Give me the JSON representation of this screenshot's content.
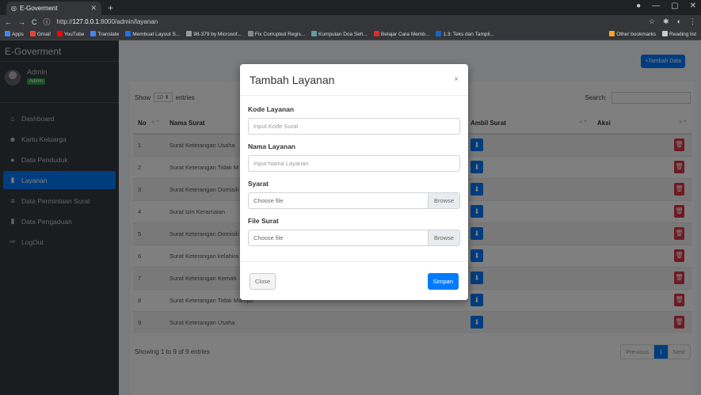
{
  "browser": {
    "tab_title": "E-Goverment",
    "url_prefix": "http://",
    "url_host": "127.0.0.1",
    "url_rest": ":8000/admin/layanan",
    "bookmarks": [
      "Apps",
      "Gmail",
      "YouTube",
      "Translate",
      "Membuat Layout S...",
      "98-379 by Microsof...",
      "Fix Corrupted Regis...",
      "Kumpulan Doa Seh...",
      "Belajar Cara Memb...",
      "1.3: Teks dan Tampil..."
    ],
    "bookmarks_right": [
      "Other bookmarks",
      "Reading list"
    ]
  },
  "sidebar": {
    "brand": "E-Goverment",
    "user_name": "Admin",
    "user_badge": "Admin",
    "items": [
      {
        "label": "Dashboard",
        "icon": "home-icon"
      },
      {
        "label": "Kartu Keluarga",
        "icon": "users-icon"
      },
      {
        "label": "Data Penduduk",
        "icon": "user-icon"
      },
      {
        "label": "Layanan",
        "icon": "file-icon"
      },
      {
        "label": "Data Permintaan Surat",
        "icon": "list-icon"
      },
      {
        "label": "Data Pengaduan",
        "icon": "file-icon"
      },
      {
        "label": "LogOut",
        "icon": "logout-icon"
      }
    ]
  },
  "main": {
    "add_button": "Tambah Data",
    "show_label": "Show",
    "show_value": "10",
    "entries_label": "entries",
    "search_label": "Search:",
    "columns": [
      "No",
      "Nama Surat",
      "Ambil Surat",
      "Aksi"
    ],
    "rows": [
      {
        "no": "1",
        "name": "Surat Keterangan Usaha"
      },
      {
        "no": "2",
        "name": "Surat Keterangan Tidak M"
      },
      {
        "no": "3",
        "name": "Surat Keterangan Domisili"
      },
      {
        "no": "4",
        "name": "Surat Izin Keramaian"
      },
      {
        "no": "5",
        "name": "Surat Keterangan Domisili"
      },
      {
        "no": "6",
        "name": "Surat Keterangan kelahira"
      },
      {
        "no": "7",
        "name": "Surat Keterangan Kemati"
      },
      {
        "no": "8",
        "name": "Surat Keterangan Tidak Mampu"
      },
      {
        "no": "9",
        "name": "Surat Keterangan Usaha"
      }
    ],
    "footer_info": "Showing 1 to 9 of 9 entries",
    "pager": {
      "prev": "Previous",
      "page": "1",
      "next": "Next"
    }
  },
  "modal": {
    "title": "Tambah Layanan",
    "close_x": "×",
    "kode_label": "Kode Layanan",
    "kode_placeholder": "Input Kode Surat",
    "nama_label": "Nama Layanan",
    "nama_placeholder": "Input Nama Layanan",
    "syarat_label": "Syarat",
    "syarat_file": "Choose file",
    "syarat_browse": "Browse",
    "file_label": "File Surat",
    "file_file": "Choose file",
    "file_browse": "Browse",
    "close_button": "Close",
    "save_button": "Simpan"
  },
  "colors": {
    "primary": "#007bff",
    "danger": "#dc3545",
    "sidebar": "#343a40"
  }
}
